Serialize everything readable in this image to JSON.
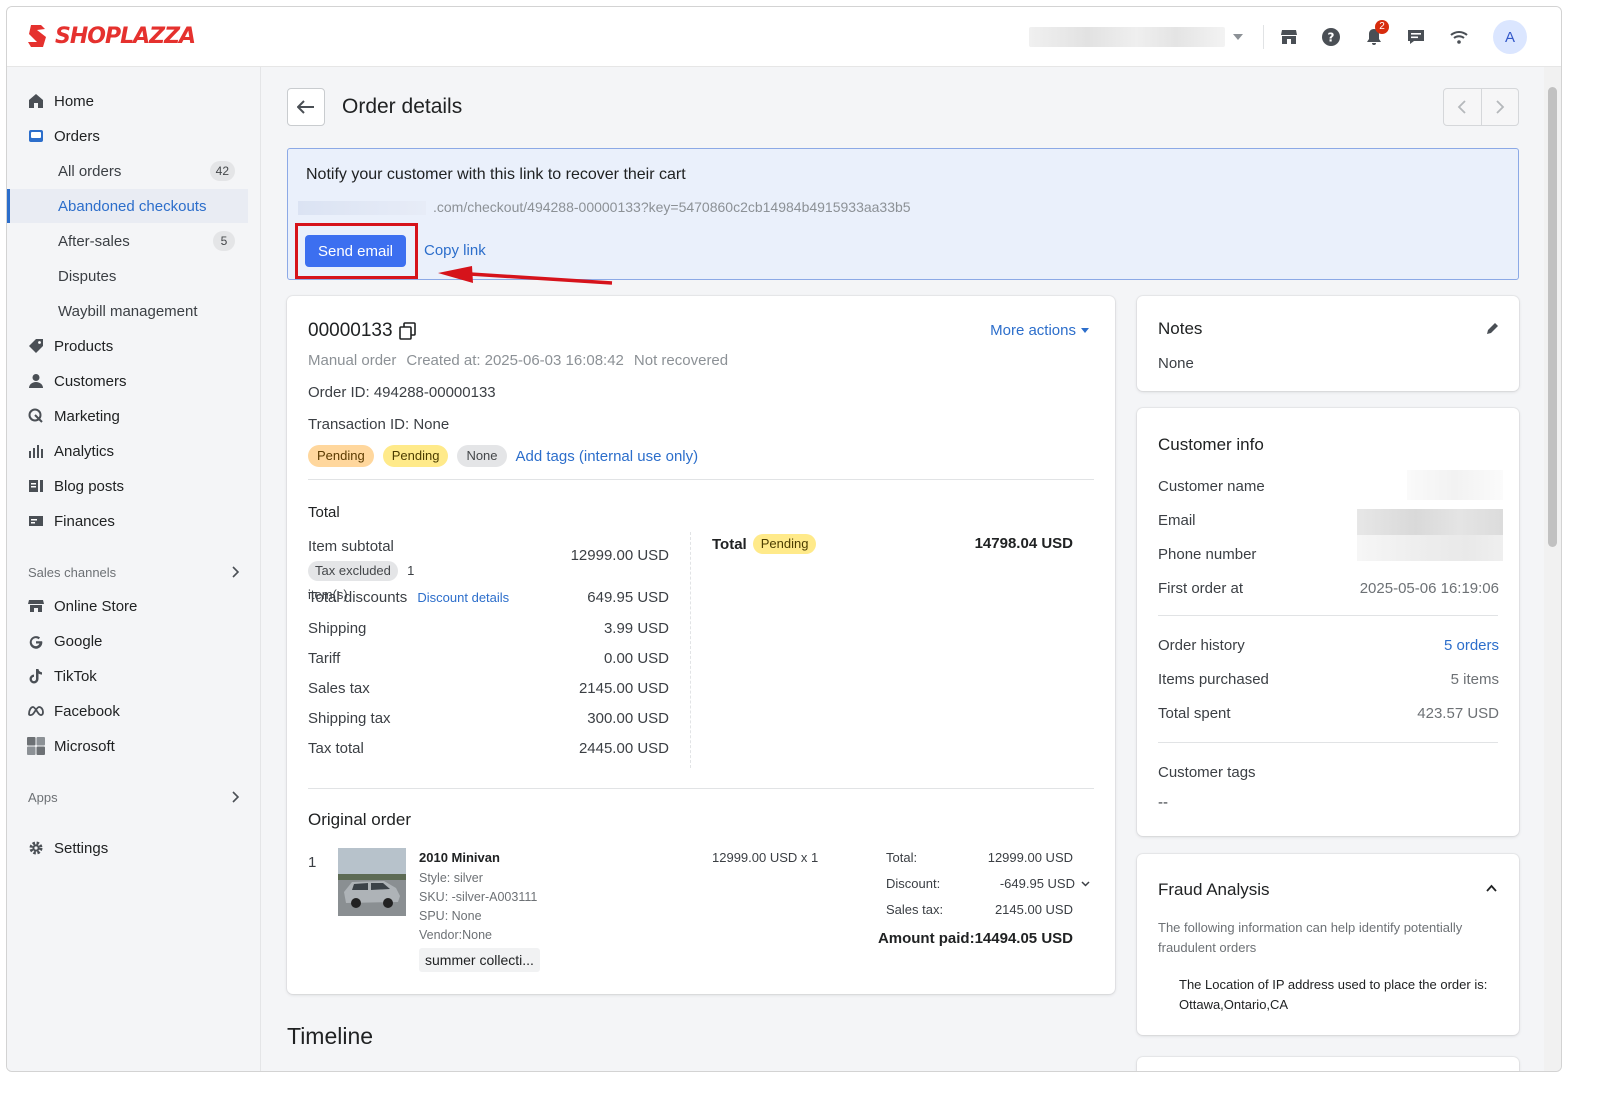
{
  "brand": {
    "logo_text": "SHOPLAZZA",
    "color": "#e5312e"
  },
  "topbar": {
    "icons": [
      "store-icon",
      "help-icon",
      "bell-icon",
      "chat-icon",
      "wifi-icon"
    ],
    "notification_count": "2",
    "avatar_letter": "A"
  },
  "sidebar": {
    "items": [
      {
        "label": "Home",
        "icon": "home-icon"
      },
      {
        "label": "Orders",
        "icon": "orders-icon"
      }
    ],
    "orders_sub": [
      {
        "label": "All orders",
        "count": "42"
      },
      {
        "label": "Abandoned checkouts"
      },
      {
        "label": "After-sales",
        "count": "5"
      },
      {
        "label": "Disputes"
      },
      {
        "label": "Waybill management"
      }
    ],
    "items2": [
      {
        "label": "Products",
        "icon": "tag-icon"
      },
      {
        "label": "Customers",
        "icon": "person-icon"
      },
      {
        "label": "Marketing",
        "icon": "marketing-icon"
      },
      {
        "label": "Analytics",
        "icon": "bar-chart-icon"
      },
      {
        "label": "Blog posts",
        "icon": "blog-icon"
      },
      {
        "label": "Finances",
        "icon": "finance-icon"
      }
    ],
    "sales_channels_label": "Sales channels",
    "channels": [
      {
        "label": "Online Store",
        "icon": "store-icon"
      },
      {
        "label": "Google",
        "icon": "google-icon"
      },
      {
        "label": "TikTok",
        "icon": "tiktok-icon"
      },
      {
        "label": "Facebook",
        "icon": "meta-icon"
      },
      {
        "label": "Microsoft",
        "icon": "microsoft-icon"
      }
    ],
    "apps_label": "Apps",
    "settings_label": "Settings"
  },
  "header": {
    "title": "Order details"
  },
  "notify": {
    "title": "Notify your customer with this link to recover their cart",
    "link": ".com/checkout/494288-00000133?key=5470860c2cb14984b4915933aa33b5",
    "send_label": "Send email",
    "copy_label": "Copy link"
  },
  "order": {
    "number": "00000133",
    "more_actions": "More actions",
    "meta": {
      "type": "Manual order",
      "created_label": "Created at:",
      "created": "2025-06-03 16:08:42",
      "status": "Not recovered"
    },
    "order_id": "Order ID: 494288-00000133",
    "transaction_id": "Transaction ID: None",
    "tags": [
      "Pending",
      "Pending",
      "None"
    ],
    "add_tags": "Add tags (internal use only)"
  },
  "totals": {
    "heading": "Total",
    "item_subtotal_label": "Item subtotal",
    "tax_excluded": "Tax excluded",
    "item_count": "1",
    "items_suffix": "item(s)",
    "item_subtotal": "12999.00 USD",
    "discounts_label": "Total discounts",
    "discount_details": "Discount details",
    "discounts": "649.95 USD",
    "lines": [
      {
        "label": "Shipping",
        "value": "3.99 USD"
      },
      {
        "label": "Tariff",
        "value": "0.00 USD"
      },
      {
        "label": "Sales tax",
        "value": "2145.00 USD"
      },
      {
        "label": "Shipping tax",
        "value": "300.00 USD"
      },
      {
        "label": "Tax total",
        "value": "2445.00 USD"
      }
    ],
    "total_label": "Total",
    "total_status": "Pending",
    "total_value": "14798.04 USD"
  },
  "original_order": {
    "heading": "Original order",
    "index": "1",
    "product_name": "2010 Minivan",
    "style": "Style: silver",
    "sku": "SKU: -silver-A003111",
    "spu": "SPU: None",
    "vendor": "Vendor:None",
    "collection": "summer collecti...",
    "price_qty": "12999.00 USD x 1",
    "summary": [
      {
        "label": "Total:",
        "value": "12999.00 USD"
      },
      {
        "label": "Discount:",
        "value": "-649.95 USD"
      },
      {
        "label": "Sales tax:",
        "value": "2145.00 USD"
      }
    ],
    "amount_paid": "Amount paid:14494.05 USD"
  },
  "timeline": {
    "heading": "Timeline"
  },
  "notes": {
    "heading": "Notes",
    "value": "None"
  },
  "customer": {
    "heading": "Customer info",
    "name_label": "Customer name",
    "email_label": "Email",
    "phone_label": "Phone number",
    "first_order_label": "First order at",
    "first_order": "2025-05-06 16:19:06",
    "history_label": "Order history",
    "history": "5 orders",
    "items_label": "Items purchased",
    "items": "5 items",
    "spent_label": "Total spent",
    "spent": "423.57 USD",
    "tags_label": "Customer tags",
    "tags": "--"
  },
  "fraud": {
    "heading": "Fraud Analysis",
    "description": "The following information can help identify potentially fraudulent orders",
    "ip_text": "The Location of IP address used to place the order is:",
    "ip_location": "Ottawa,Ontario,CA"
  }
}
